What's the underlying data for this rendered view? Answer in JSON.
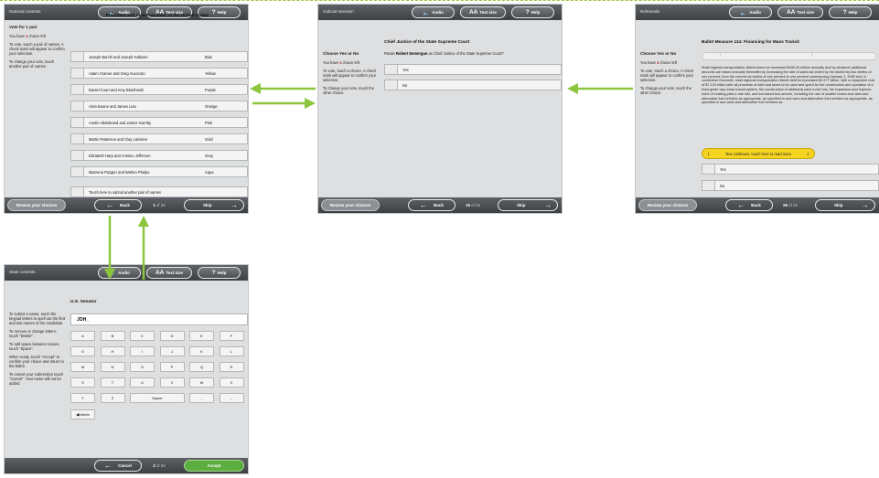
{
  "common": {
    "audio": "Audio",
    "text_size": "Text size",
    "help": "Help",
    "review": "Review your choices",
    "back": "Back",
    "skip": "Skip",
    "of": "of 26",
    "audio_icon": "speaker-icon",
    "text_size_icon": "AA",
    "help_icon": "?"
  },
  "national": {
    "section": "National contests",
    "title": "President and Vice-President of the United States",
    "vote_for": "Vote for 1 pair",
    "have_pre": "You have",
    "have_num": "1",
    "have_post": "choice left",
    "instr1": "To vote, touch a pair of names. A check mark will appear to confirm your selection.",
    "instr2": "To change your vote, touch another pair of names.",
    "page": "1",
    "candidates": [
      {
        "name": "Joseph Barchi and Joseph Hallaren",
        "party": "Blue"
      },
      {
        "name": "Adam Cramer and Greg Vuoccolo",
        "party": "Yellow"
      },
      {
        "name": "Daniel Court and Amy Blumhardt",
        "party": "Purple"
      },
      {
        "name": "Alvin Boone and James Lian",
        "party": "Orange"
      },
      {
        "name": "Austin Hildebrand and James Garritty",
        "party": "Pink"
      },
      {
        "name": "Martin Patterson and Clay Lariviere",
        "party": "Gold"
      },
      {
        "name": "Elizabeth Harp and Antoine Jefferson",
        "party": "Gray"
      },
      {
        "name": "Marzena Pazgier and Welton Phelps",
        "party": "Aqua"
      }
    ],
    "write_in": "Touch here to submit another pair of names"
  },
  "judicial": {
    "section": "Judicial retention",
    "title": "Chief Justice of the State Supreme Court",
    "choose": "Choose Yes or No",
    "have_pre": "You have",
    "have_num": "1",
    "have_post": "choice left",
    "instr1": "To vote, touch a choice. A check mark will appear to confirm your selection.",
    "instr2": "To change your vote, touch the other choice.",
    "retain_pre": "Retain",
    "retain_name": "Robert Demergue",
    "retain_post": "as Chief Justice of the State Supreme Court?",
    "yes": "Yes",
    "no": "No",
    "page": "15"
  },
  "referenda": {
    "section": "Referenda",
    "title": "Ballot Measure 114: Financing for Mass Transit",
    "choose": "Choose Yes or No",
    "have_pre": "You have",
    "have_num": "1",
    "have_post": "choice left",
    "instr1": "To vote, touch a choice. A check mark will appear to confirm your selection.",
    "instr2": "To change your vote, touch the other choice.",
    "description": "Shall regional transportation district taxes be increased $158.34 million annually and by whatever additional amounts are raised annually thereafter by increasing the rate of sales tax levied by the district by four-tenths of one percent, from the current six-tenths of one percent to one percent commencing January 1, 2005 and, in connection therewith, shall regional transportation district debt be increased $3.477 billion, with a repayment cost of $7.129 billion with all proceeds of debt and taxes to be used and spent for the construction and operation of a fixed guide way mass transit system, the construction of additional park-n-ride lots, the expansion and improve-ment of existing park-n-ride lots, and increased bus service, including the use of smaller buses and vans and alternative fuel vehicles as appropriate, as specified in and vans and alternative fuel vehicles as appropriate, as specified in and vans and alternative fuel vehicles as",
    "more": "Text continues, touch here to read more",
    "yes": "Yes",
    "no": "No",
    "page": "26"
  },
  "state": {
    "section": "State contests",
    "title": "U.S. Senator",
    "instructions": [
      "To submit a name, touch the keypad letters to spell out the first and last names of the candidate.",
      "To remove or change letters, touch \"Delete\".",
      "To add space between names, touch \"Space\".",
      "When ready, touch \"Accept\" to confirm your choice and return to the ballot.",
      "To cancel your submission touch \"Cancel\". Your name will not be added."
    ],
    "entry": "JOH_",
    "keys": [
      [
        "A",
        "B",
        "C",
        "D",
        "E",
        "F"
      ],
      [
        "G",
        "H",
        "I",
        "J",
        "K",
        "L"
      ],
      [
        "M",
        "N",
        "O",
        "P",
        "Q",
        "R"
      ],
      [
        "S",
        "T",
        "U",
        "V",
        "W",
        "X"
      ],
      [
        "Y",
        "Z",
        "Space",
        "-",
        "–"
      ]
    ],
    "delete": "Delete",
    "cancel": "Cancel",
    "accept": "Accept",
    "page": "2"
  },
  "colors": {
    "arrow_green": "#8cc63f",
    "accept_green": "#5aad3e",
    "highlight_yellow": "#f5d422",
    "count_red": "#c4101a"
  }
}
